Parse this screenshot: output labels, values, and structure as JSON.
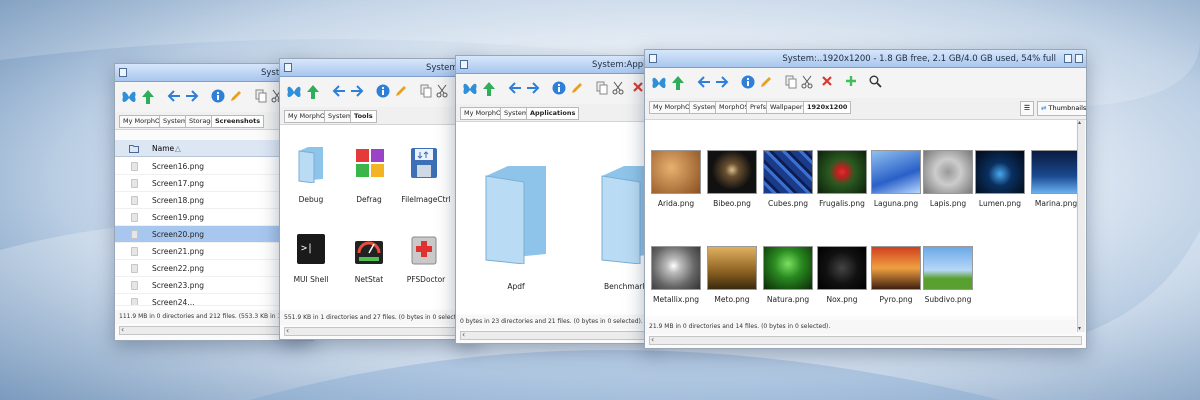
{
  "window1": {
    "title": "System:",
    "breadcrumbs": [
      "My MorphOS",
      "System:",
      "Storage",
      "Screenshots"
    ],
    "list_header": {
      "name": "Name"
    },
    "files": [
      "Screen16.png",
      "Screen17.png",
      "Screen18.png",
      "Screen19.png",
      "Screen20.png",
      "Screen21.png",
      "Screen22.png",
      "Screen23.png",
      "Screen24..."
    ],
    "selected_file": "Screen20.png",
    "status": "111.9 MB in 0 directories and 212 files. (553.3 KB in 1 selected)."
  },
  "window2": {
    "title": "System:To",
    "breadcrumbs": [
      "My MorphOS",
      "System:",
      "Tools"
    ],
    "icons": [
      "Debug",
      "Defrag",
      "FileImageCtrl",
      "MUI Shell",
      "NetStat",
      "PFSDoctor"
    ],
    "status": "551.9 KB in 1 directories and 27 files. (0 bytes in 0 selected)."
  },
  "window3": {
    "title": "System:Application",
    "breadcrumbs": [
      "My MorphOS",
      "System:",
      "Applications"
    ],
    "icons": [
      "Apdf",
      "Benchmark"
    ],
    "status": "0 bytes in 23 directories and 21 files. (0 bytes in 0 selected)."
  },
  "window4": {
    "title": "System:..1920x1200 - 1.8 GB free, 2.1 GB/4.0 GB used, 54% full",
    "breadcrumbs": [
      "My MorphOS",
      "System:",
      "MorphOS",
      "Prefs",
      "Wallpapers",
      "1920x1200"
    ],
    "view_button": "Thumbnails",
    "thumbnails": [
      "Arida.png",
      "Bibeo.png",
      "Cubes.png",
      "Frugalis.png",
      "Laguna.png",
      "Lapis.png",
      "Lumen.png",
      "Marina.png",
      "Metallix.png",
      "Meto.png",
      "Natura.png",
      "Nox.png",
      "Pyro.png",
      "Subdivo.png"
    ],
    "status": "21.9 MB in 0 directories and 14 files. (0 bytes in 0 selected)."
  },
  "colors": {
    "selection": "#a7c7ef",
    "titlebar": "#a9c6ee",
    "accent_blue": "#2f7fd8",
    "green": "#2fae5a",
    "red": "#d83a2f"
  },
  "toolbar_icons": [
    "butterfly-icon",
    "up-arrow-icon",
    "back-arrow-icon",
    "forward-arrow-icon",
    "info-icon",
    "rename-pencil-icon",
    "copy-icon",
    "cut-scissors-icon",
    "delete-x-icon",
    "new-plus-icon",
    "search-icon"
  ]
}
